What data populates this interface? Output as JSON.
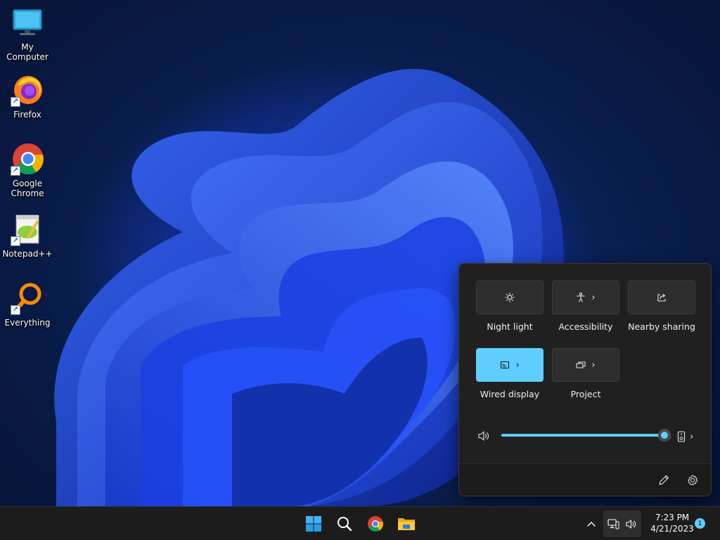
{
  "desktop": {
    "icons": [
      {
        "label": "My Computer",
        "icon": "monitor-icon"
      },
      {
        "label": "Firefox",
        "icon": "firefox-icon"
      },
      {
        "label": "Google Chrome",
        "icon": "chrome-icon"
      },
      {
        "label": "Notepad++",
        "icon": "notepad-plus-plus-icon"
      },
      {
        "label": "Everything",
        "icon": "everything-search-icon"
      }
    ],
    "shortcut_arrow": "↗"
  },
  "quick_settings": {
    "tiles": [
      {
        "label": "Night light",
        "icon": "night-light-icon",
        "active": false,
        "has_chevron": false
      },
      {
        "label": "Accessibility",
        "icon": "accessibility-icon",
        "active": false,
        "has_chevron": true
      },
      {
        "label": "Nearby sharing",
        "icon": "share-icon",
        "active": false,
        "has_chevron": false
      },
      {
        "label": "Wired display",
        "icon": "cast-icon",
        "active": true,
        "has_chevron": true
      },
      {
        "label": "Project",
        "icon": "project-icon",
        "active": false,
        "has_chevron": true
      }
    ],
    "chevron": "›",
    "volume": {
      "level_percent": 100,
      "icon": "speaker-icon",
      "output_icon": "speaker-device-icon"
    },
    "footer": {
      "edit_icon": "pencil-icon",
      "settings_icon": "gear-icon"
    },
    "accent": "#60cdff"
  },
  "taskbar": {
    "pinned": [
      "windows-start-icon",
      "search-icon",
      "chrome-icon",
      "file-explorer-icon"
    ],
    "tray": {
      "overflow_icon": "chevron-up-icon",
      "network_icon": "network-icon",
      "volume_icon": "speaker-icon",
      "time": "7:23 PM",
      "date": "4/21/2023",
      "notification_count": "1"
    }
  }
}
